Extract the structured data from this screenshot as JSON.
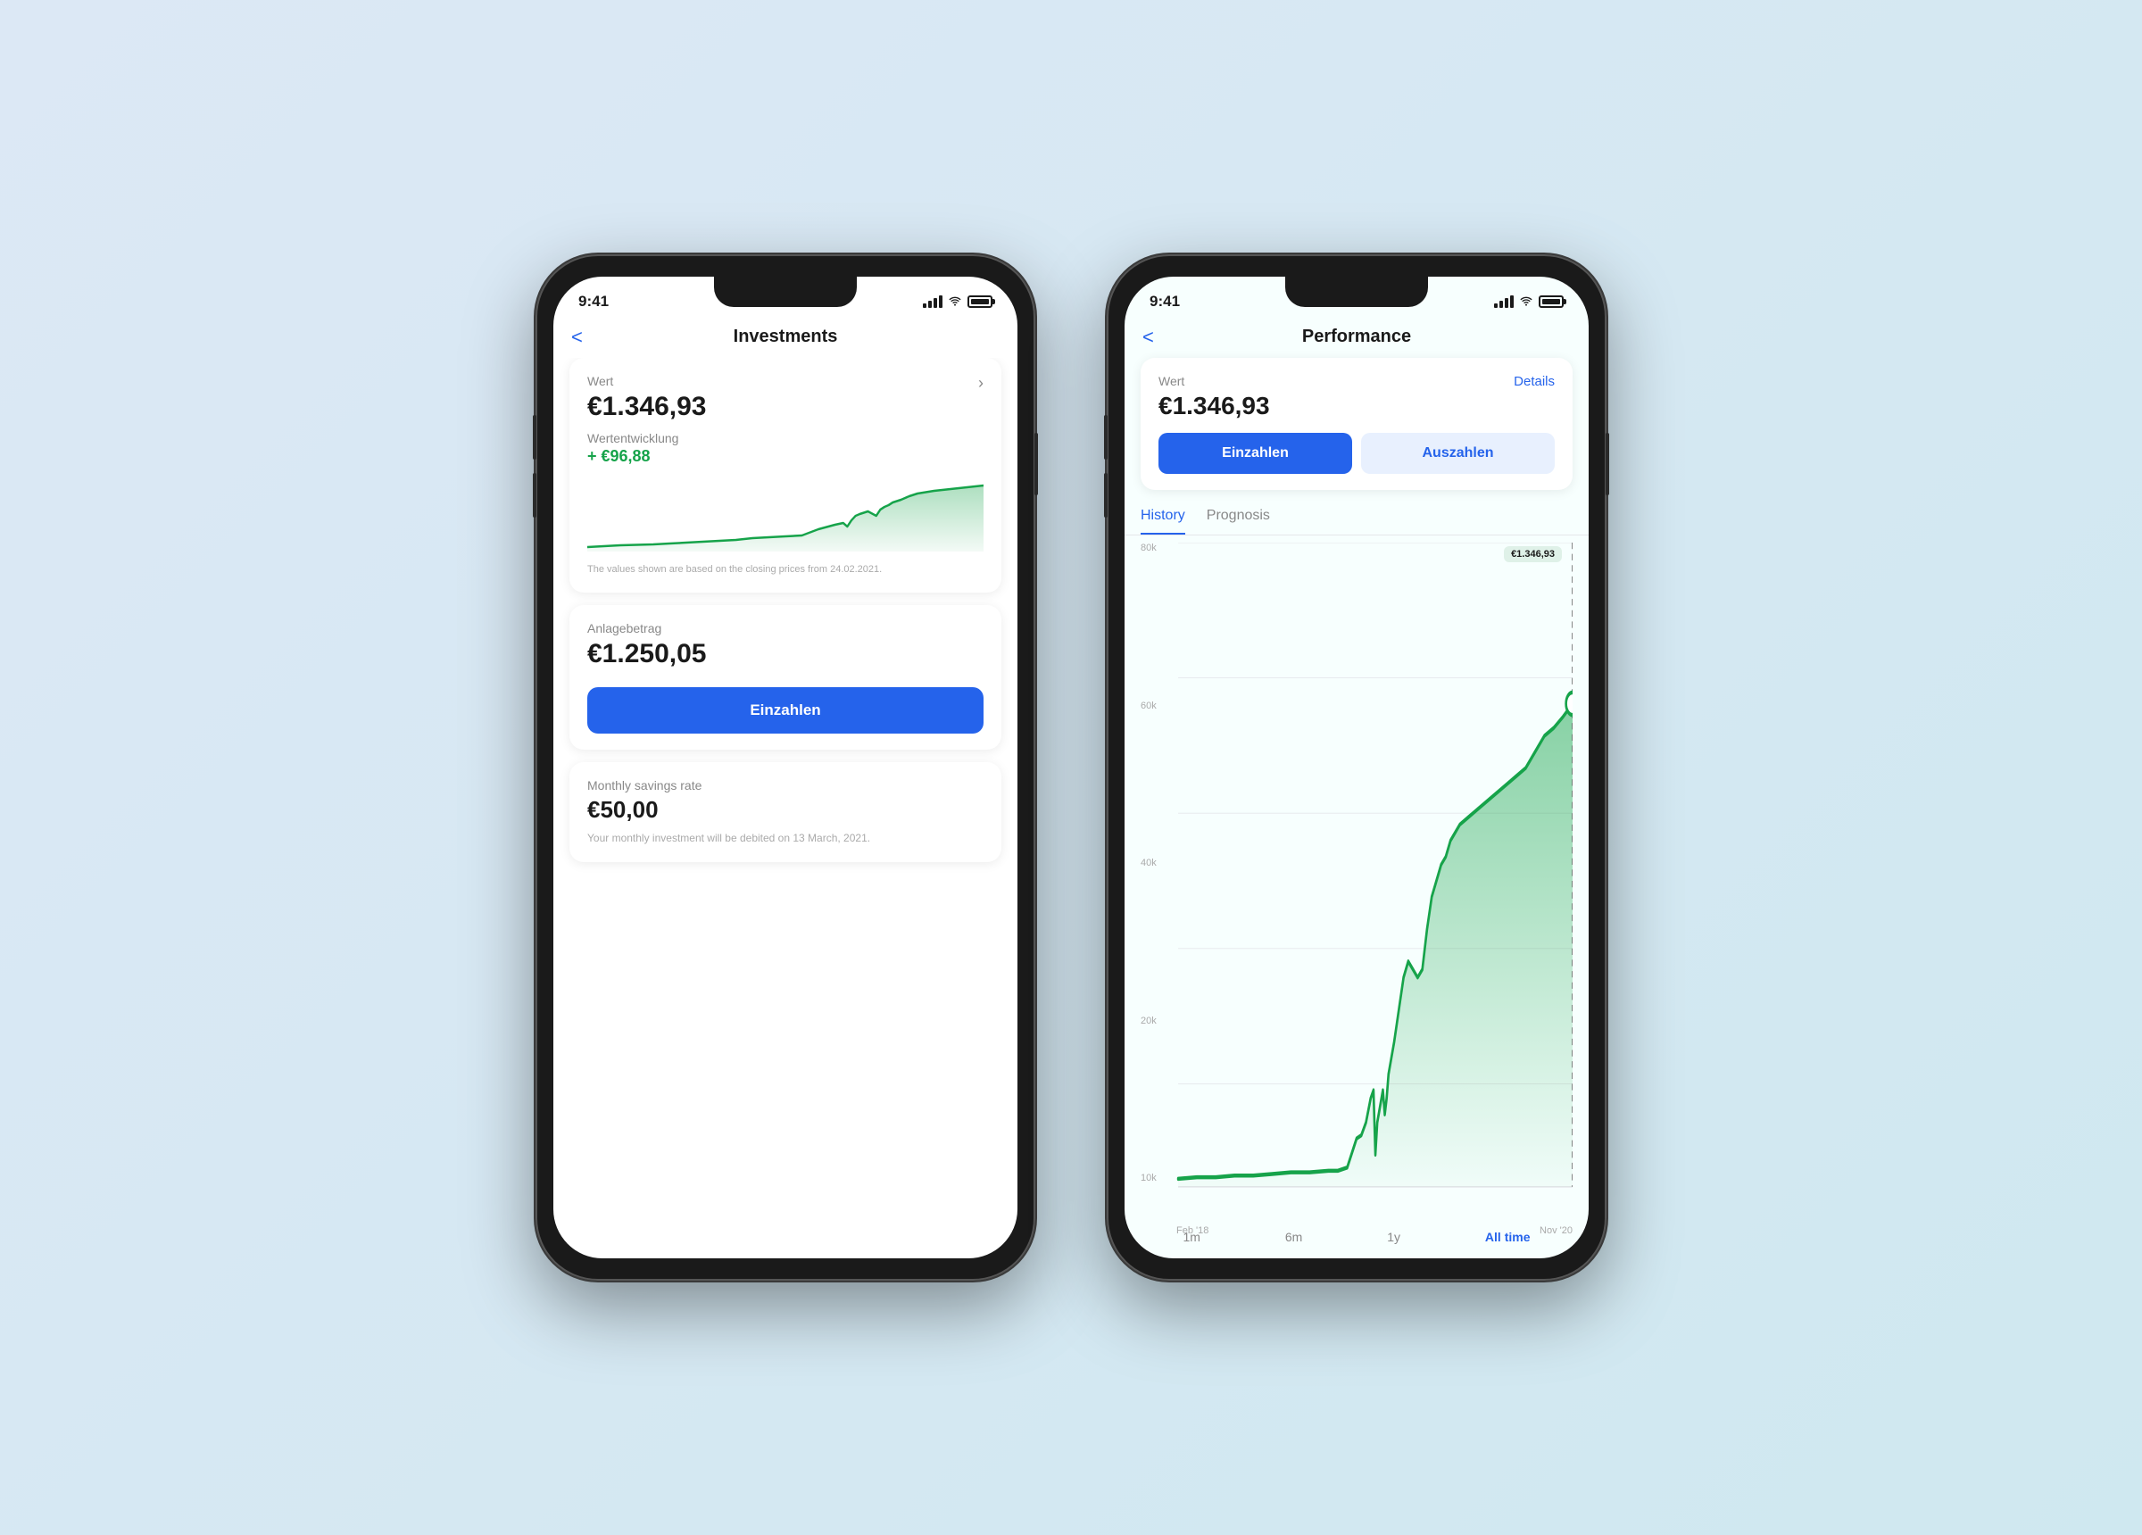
{
  "background": {
    "left_color": "#dce8f5",
    "right_color": "#cfe8f0"
  },
  "phone1": {
    "status": {
      "time": "9:41",
      "signal": "full",
      "wifi": true,
      "battery": "full"
    },
    "nav": {
      "back_label": "<",
      "title": "Investments"
    },
    "card1": {
      "label": "Wert",
      "value": "€1.346,93",
      "sub_label": "Wertentwicklung",
      "growth": "+ €96,88",
      "disclaimer": "The values shown are based on the closing prices from 24.02.2021."
    },
    "card2": {
      "label": "Anlagebetrag",
      "value": "€1.250,05",
      "button_label": "Einzahlen"
    },
    "card3": {
      "label": "Monthly savings rate",
      "value": "€50,00",
      "description": "Your monthly investment will be debited on 13 March, 2021."
    }
  },
  "phone2": {
    "status": {
      "time": "9:41",
      "signal": "full",
      "wifi": true,
      "battery": "full"
    },
    "nav": {
      "back_label": "<",
      "title": "Performance"
    },
    "card": {
      "label": "Wert",
      "value": "€1.346,93",
      "details_label": "Details",
      "btn_einzahlen": "Einzahlen",
      "btn_auszahlen": "Auszahlen"
    },
    "tabs": [
      {
        "label": "History",
        "active": true
      },
      {
        "label": "Prognosis",
        "active": false
      }
    ],
    "chart": {
      "y_labels": [
        "80k",
        "60k",
        "40k",
        "20k",
        "10k"
      ],
      "x_labels": [
        "Feb '18",
        "Nov '20"
      ],
      "tooltip_value": "€1.346,93",
      "time_filters": [
        "1m",
        "6m",
        "1y",
        "All time"
      ]
    }
  }
}
